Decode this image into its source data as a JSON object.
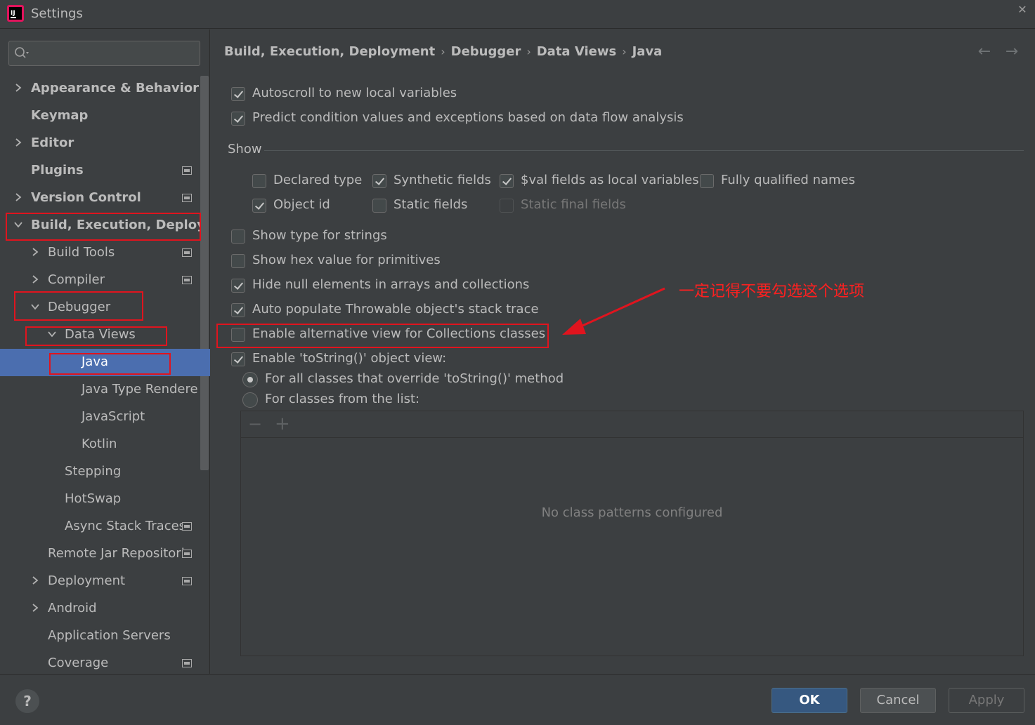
{
  "window": {
    "title": "Settings",
    "close_glyph": "✕",
    "logo_text": "IJ"
  },
  "search": {
    "value": "",
    "placeholder": ""
  },
  "sidebar": {
    "items": [
      {
        "label": "Appearance & Behavior"
      },
      {
        "label": "Keymap"
      },
      {
        "label": "Editor"
      },
      {
        "label": "Plugins"
      },
      {
        "label": "Version Control"
      },
      {
        "label": "Build, Execution, Deploym"
      },
      {
        "label": "Build Tools"
      },
      {
        "label": "Compiler"
      },
      {
        "label": "Debugger"
      },
      {
        "label": "Data Views"
      },
      {
        "label": "Java"
      },
      {
        "label": "Java Type Rendere"
      },
      {
        "label": "JavaScript"
      },
      {
        "label": "Kotlin"
      },
      {
        "label": "Stepping"
      },
      {
        "label": "HotSwap"
      },
      {
        "label": "Async Stack Traces"
      },
      {
        "label": "Remote Jar Repositori"
      },
      {
        "label": "Deployment"
      },
      {
        "label": "Android"
      },
      {
        "label": "Application Servers"
      },
      {
        "label": "Coverage"
      }
    ]
  },
  "breadcrumb": [
    "Build, Execution, Deployment",
    "Debugger",
    "Data Views",
    "Java"
  ],
  "breadcrumb_sep": "›",
  "nav": {
    "back": "←",
    "forward": "→"
  },
  "options": {
    "autoscroll": {
      "label": "Autoscroll to new local variables",
      "checked": true
    },
    "predict": {
      "label": "Predict condition values and exceptions based on data flow analysis",
      "checked": true
    }
  },
  "show_group": {
    "label": "Show",
    "items": {
      "declared_type": {
        "label": "Declared type",
        "checked": false
      },
      "synthetic_fields": {
        "label": "Synthetic fields",
        "checked": true
      },
      "val_fields": {
        "label": "$val fields as local variables",
        "checked": true
      },
      "fully_qualified": {
        "label": "Fully qualified names",
        "checked": false
      },
      "object_id": {
        "label": "Object id",
        "checked": true
      },
      "static_fields": {
        "label": "Static fields",
        "checked": false
      },
      "static_final_fields": {
        "label": "Static final fields",
        "checked": false,
        "disabled": true
      }
    }
  },
  "more_options": {
    "type_strings": {
      "label": "Show type for strings",
      "checked": false
    },
    "hex_primitives": {
      "label": "Show hex value for primitives",
      "checked": false
    },
    "hide_null": {
      "label": "Hide null elements in arrays and collections",
      "checked": true
    },
    "auto_populate": {
      "label": "Auto populate Throwable object's stack trace",
      "checked": true
    },
    "alt_view": {
      "label": "Enable alternative view for Collections classes",
      "checked": false
    },
    "tostring_view": {
      "label": "Enable 'toString()' object view:",
      "checked": true
    }
  },
  "tostring_radios": {
    "all_classes": {
      "label": "For all classes that override 'toString()' method",
      "selected": true
    },
    "from_list": {
      "label": "For classes from the list:",
      "selected": false
    }
  },
  "class_list": {
    "remove": "−",
    "add": "+",
    "empty_text": "No class patterns configured"
  },
  "annotation": {
    "text": "一定记得不要勾选这个选项",
    "color": "#e0141e"
  },
  "buttons": {
    "help": "?",
    "ok": "OK",
    "cancel": "Cancel",
    "apply": "Apply"
  },
  "colors": {
    "background": "#3c3f41",
    "selection": "#4b6eaf",
    "ok_button": "#365880",
    "text": "#bbbbbb"
  }
}
